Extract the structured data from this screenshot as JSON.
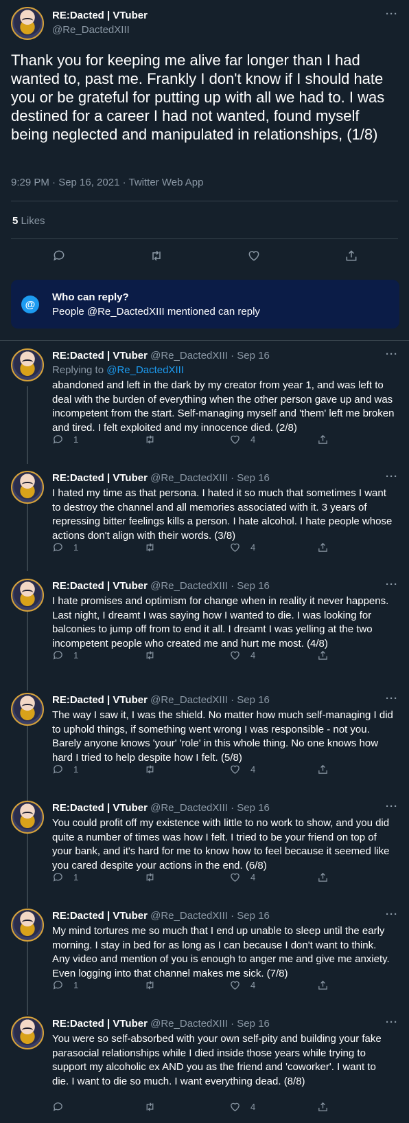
{
  "main_tweet": {
    "name": "RE:Dacted | VTuber",
    "handle": "@Re_DactedXIII",
    "more": "···",
    "text": "Thank you for keeping me alive far longer than I had wanted to, past me. Frankly I don't know if I should hate you or be grateful for putting up with all we had to. I was destined for a career I had not wanted, found myself being neglected and manipulated in relationships, (1/8)",
    "meta": "9:29 PM · Sep 16, 2021 · Twitter Web App",
    "likes_count": "5",
    "likes_label": "Likes"
  },
  "who_can_reply": {
    "icon": "@",
    "title": "Who can reply?",
    "description": "People @Re_DactedXIII mentioned can reply"
  },
  "replies": [
    {
      "name": "RE:Dacted | VTuber",
      "handle": "@Re_DactedXIII",
      "dot": "·",
      "date": "Sep 16",
      "replying_prefix": "Replying to ",
      "replying_to": "@Re_DactedXIII",
      "text": "abandoned and left in the dark by my creator from year 1, and was left to deal with the burden of everything when the other person gave up and was incompetent from the start. Self-managing myself and 'them' left me broken and tired. I felt exploited and my innocence died. (2/8)",
      "reply_count": "1",
      "like_count": "4"
    },
    {
      "name": "RE:Dacted | VTuber",
      "handle": "@Re_DactedXIII",
      "dot": "·",
      "date": "Sep 16",
      "text": "I hated my time as that persona. I hated it so much that sometimes I want to destroy the channel and all memories associated with it. 3 years of repressing bitter feelings kills a person. I hate alcohol. I hate people whose actions don't align with their words. (3/8)",
      "reply_count": "1",
      "like_count": "4"
    },
    {
      "name": "RE:Dacted | VTuber",
      "handle": "@Re_DactedXIII",
      "dot": "·",
      "date": "Sep 16",
      "text": "I hate promises and optimism for change when in reality it never happens. Last night, I dreamt I was saying how I wanted to die. I was looking for balconies to jump off from to end it all. I dreamt I was yelling at the two incompetent people who created me and hurt me most. (4/8)",
      "reply_count": "1",
      "like_count": "4"
    },
    {
      "name": "RE:Dacted | VTuber",
      "handle": "@Re_DactedXIII",
      "dot": "·",
      "date": "Sep 16",
      "text": "The way I saw it, I was the shield. No matter how much self-managing I did to uphold things, if something went wrong I was responsible - not you. Barely anyone knows 'your' 'role' in this whole thing. No one knows how hard I tried to help despite how I felt. (5/8)",
      "reply_count": "1",
      "like_count": "4"
    },
    {
      "name": "RE:Dacted | VTuber",
      "handle": "@Re_DactedXIII",
      "dot": "·",
      "date": "Sep 16",
      "text": "You could profit off my existence with little to no work to show, and you did quite a number of times was how I felt. I tried to be your friend on top of your bank, and it's hard for me to know how to feel because it seemed like you cared despite your actions in the end. (6/8)",
      "reply_count": "1",
      "like_count": "4"
    },
    {
      "name": "RE:Dacted | VTuber",
      "handle": "@Re_DactedXIII",
      "dot": "·",
      "date": "Sep 16",
      "text": "My mind tortures me so much that I end up unable to sleep until the early morning. I stay in bed for as long as I can because I don't want to think. Any video and mention of you is enough to anger me and give me anxiety. Even logging into that channel makes me sick. (7/8)",
      "reply_count": "1",
      "like_count": "4"
    },
    {
      "name": "RE:Dacted | VTuber",
      "handle": "@Re_DactedXIII",
      "dot": "·",
      "date": "Sep 16",
      "text": "You were so self-absorbed with your own self-pity and building your fake parasocial relationships while I died inside those years while trying to support my alcoholic ex AND you as the friend and 'coworker'. I want to die. I want to die so much. I want everything dead. (8/8)",
      "reply_count": "",
      "like_count": "4"
    }
  ],
  "colors": {
    "background": "#15202b",
    "secondary_text": "#8b98a5",
    "accent": "#1d9bf0",
    "divider": "#38444d",
    "reply_banner": "#0b1c47"
  },
  "icons": {
    "reply": "comment-icon",
    "retweet": "retweet-icon",
    "like": "heart-icon",
    "share": "share-icon",
    "more": "more-icon"
  }
}
